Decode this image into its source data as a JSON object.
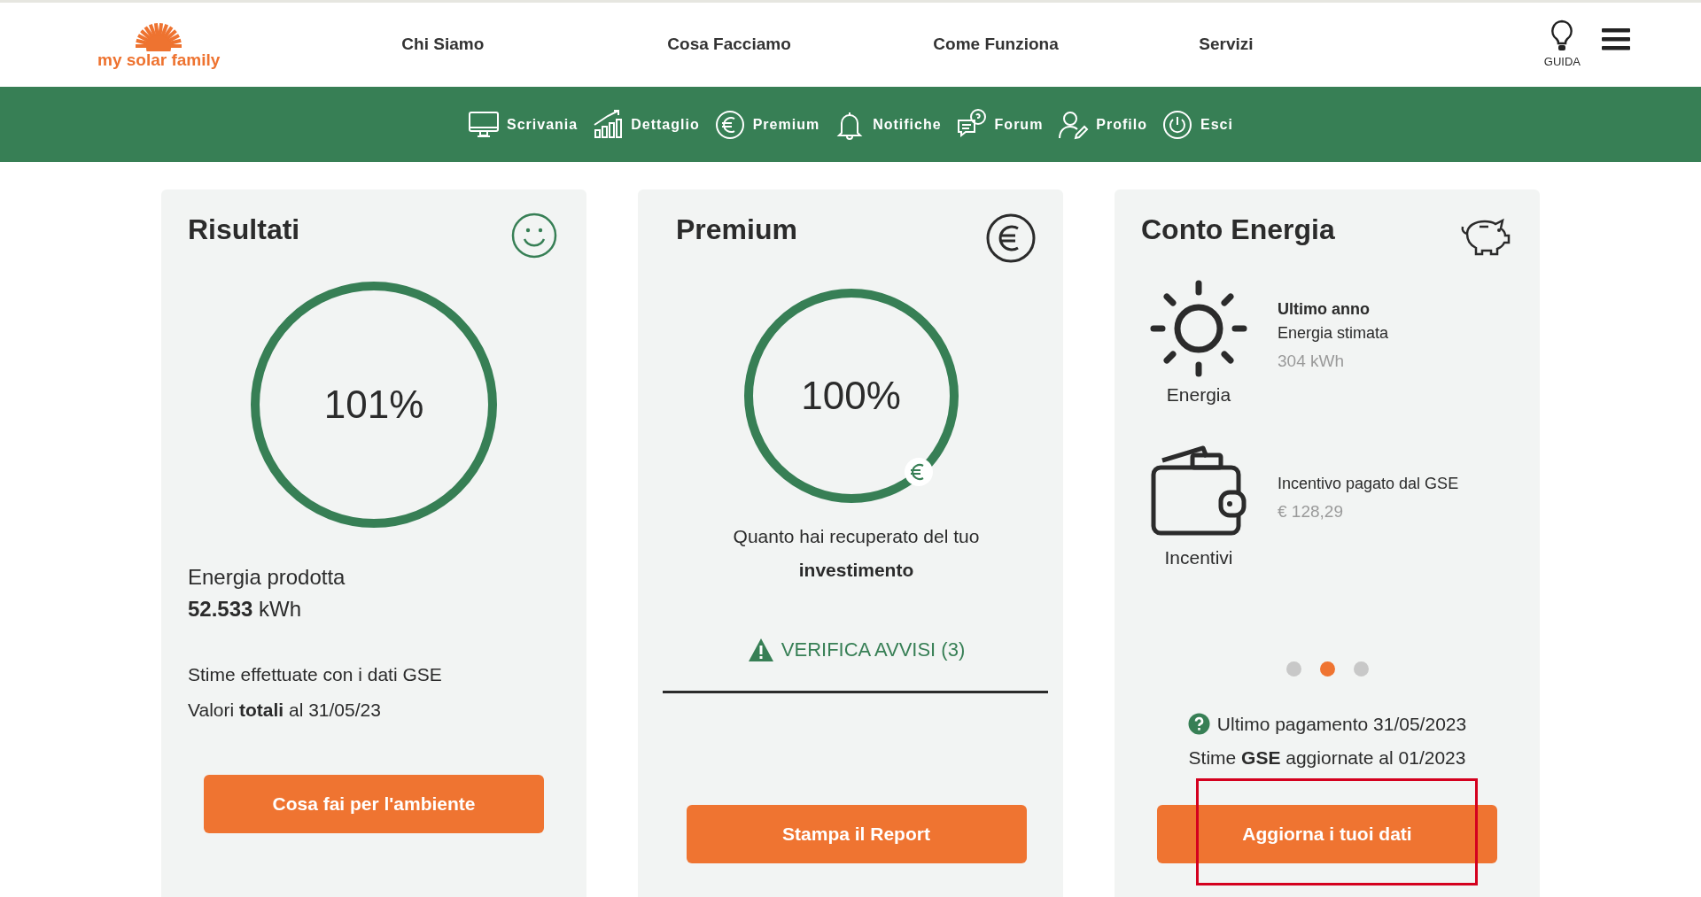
{
  "header": {
    "logo": "my solar family",
    "nav": [
      "Chi Siamo",
      "Cosa Facciamo",
      "Come Funziona",
      "Servizi"
    ],
    "guide_label": "GUIDA"
  },
  "toolbar": [
    {
      "label": "Scrivania",
      "kind": "monitor"
    },
    {
      "label": "Dettaglio",
      "kind": "chart"
    },
    {
      "label": "Premium",
      "kind": "euro"
    },
    {
      "label": "Notifiche",
      "kind": "bell"
    },
    {
      "label": "Forum",
      "kind": "chat"
    },
    {
      "label": "Profilo",
      "kind": "user"
    },
    {
      "label": "Esci",
      "kind": "power"
    }
  ],
  "results": {
    "title": "Risultati",
    "ring": {
      "label": "101%",
      "level": 1
    },
    "energy_label": "Energia prodotta",
    "energy_value": "**52.533** kWh",
    "note_1": "Stime effettuate con i dati GSE",
    "note_2": "Valori **totali** al 31/05/23",
    "button": {
      "label": "Cosa fai per l'ambiente",
      "highlighted": false
    }
  },
  "premium": {
    "title": "Premium",
    "ring": {
      "label": "100%",
      "level": 1
    },
    "caption_1": "Quanto hai recuperato del tuo",
    "caption_2": "investimento",
    "warning": "VERIFICA AVVISI (3)",
    "button": {
      "label": "Stampa il Report",
      "highlighted": false
    }
  },
  "conto_energia": {
    "title": "Conto Energia",
    "items": [
      {
        "kind": "sun",
        "icon_label": "Energia",
        "heading": "Ultimo anno",
        "label": "Energia stimata",
        "value": "304 kWh"
      },
      {
        "kind": "wallet",
        "icon_label": "Incentivi",
        "label": "Incentivo pagato dal GSE",
        "value": "€ 128,29"
      }
    ],
    "dots": [
      {
        "selected": false
      },
      {
        "selected": true
      },
      {
        "selected": false
      }
    ],
    "payment": "Ultimo pagamento 31/05/2023",
    "updated": "Stime **GSE** aggiornate al 01/2023",
    "button": {
      "label": "Aggiorna i tuoi dati",
      "highlighted": true
    }
  }
}
